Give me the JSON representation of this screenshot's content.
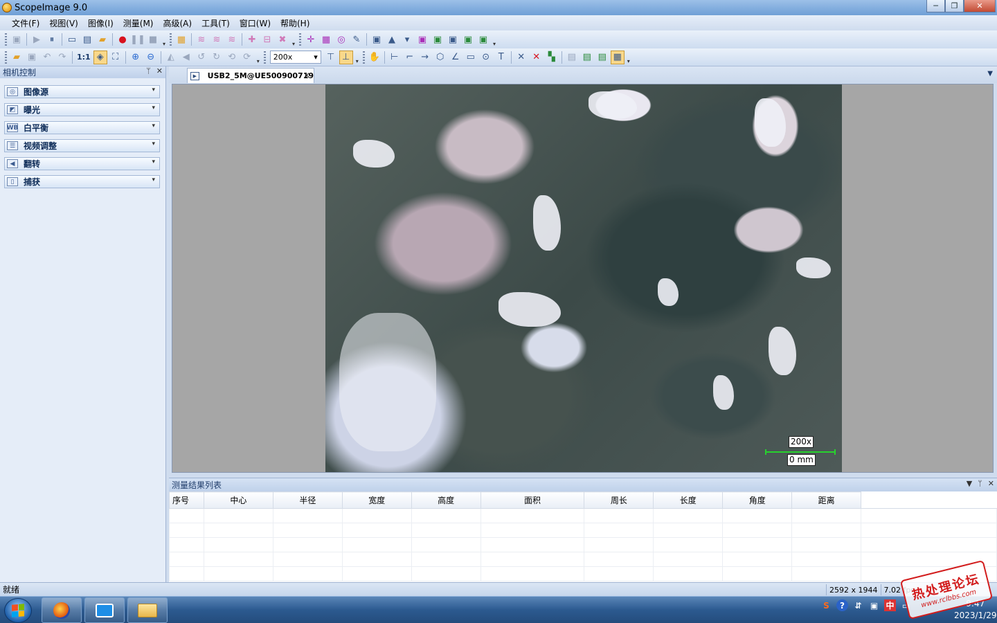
{
  "window": {
    "title": "ScopeImage 9.0",
    "min": "─",
    "max": "❐",
    "close": "✕"
  },
  "menu": [
    "文件(F)",
    "视图(V)",
    "图像(I)",
    "测量(M)",
    "高级(A)",
    "工具(T)",
    "窗口(W)",
    "帮助(H)"
  ],
  "toolbar": {
    "ratio_label": "1:1",
    "zoom_value": "200x",
    "zoom_arrow": "▾",
    "overflow": "▾"
  },
  "left_panel": {
    "title": "相机控制",
    "pin": "ᛘ",
    "close": "✕",
    "sections": [
      {
        "label": "图像源",
        "icon": "camera-source-icon"
      },
      {
        "label": "曝光",
        "icon": "exposure-icon"
      },
      {
        "label": "白平衡",
        "icon": "white-balance-icon"
      },
      {
        "label": "视频调整",
        "icon": "video-adjust-icon"
      },
      {
        "label": "翻转",
        "icon": "flip-icon"
      },
      {
        "label": "捕获",
        "icon": "capture-icon"
      }
    ],
    "section_arrow": "▾"
  },
  "document": {
    "tab_label": "USB2_5M@UE500900719",
    "tab_close": "✕",
    "menu_arrow": "▼",
    "scale_magnification": "200x",
    "scale_length": "0 mm"
  },
  "results": {
    "title": "测量结果列表",
    "ctrl_down": "▼",
    "ctrl_pin": "ᛘ",
    "ctrl_close": "✕",
    "columns": [
      "序号",
      "中心",
      "半径",
      "宽度",
      "高度",
      "面积",
      "周长",
      "长度",
      "角度",
      "距离"
    ]
  },
  "status": {
    "text": "就绪",
    "resolution": "2592 x 1944",
    "fps": "7.02 fps"
  },
  "taskbar": {
    "clock_time": "9:47",
    "clock_date": "2023/1/29"
  },
  "watermark": {
    "line1": "热处理论坛",
    "line2": "www.rclbbs.com"
  },
  "colors": {
    "accent": "#cfdcee",
    "scale_bar": "#27d22d",
    "record": "#d8121e"
  }
}
